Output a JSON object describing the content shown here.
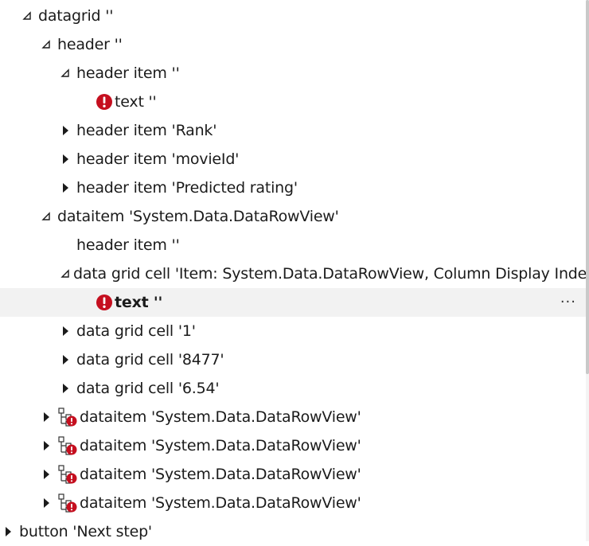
{
  "tree": {
    "rows": [
      {
        "label": "datagrid ''",
        "expander": "expanded",
        "icon": "none"
      },
      {
        "label": "header ''",
        "expander": "expanded",
        "icon": "none"
      },
      {
        "label": "header item ''",
        "expander": "expanded",
        "icon": "none"
      },
      {
        "label": "text ''",
        "expander": "none",
        "icon": "error-icon"
      },
      {
        "label": "header item 'Rank'",
        "expander": "collapsed",
        "icon": "none"
      },
      {
        "label": "header item 'movieId'",
        "expander": "collapsed",
        "icon": "none"
      },
      {
        "label": "header item 'Predicted rating'",
        "expander": "collapsed",
        "icon": "none"
      },
      {
        "label": "dataitem 'System.Data.DataRowView'",
        "expander": "expanded",
        "icon": "none"
      },
      {
        "label": "header item ''",
        "expander": "none",
        "icon": "none"
      },
      {
        "label": "data grid cell 'Item: System.Data.DataRowView, Column Display Index",
        "expander": "expanded",
        "icon": "none"
      },
      {
        "label": "text ''",
        "expander": "none",
        "icon": "error-icon",
        "selected": true,
        "more": "···"
      },
      {
        "label": "data grid cell '1'",
        "expander": "collapsed",
        "icon": "none"
      },
      {
        "label": "data grid cell '8477'",
        "expander": "collapsed",
        "icon": "none"
      },
      {
        "label": "data grid cell '6.54'",
        "expander": "collapsed",
        "icon": "none"
      },
      {
        "label": "dataitem 'System.Data.DataRowView'",
        "expander": "collapsed",
        "icon": "tree-error-icon"
      },
      {
        "label": "dataitem 'System.Data.DataRowView'",
        "expander": "collapsed",
        "icon": "tree-error-icon"
      },
      {
        "label": "dataitem 'System.Data.DataRowView'",
        "expander": "collapsed",
        "icon": "tree-error-icon"
      },
      {
        "label": "dataitem 'System.Data.DataRowView'",
        "expander": "collapsed",
        "icon": "tree-error-icon"
      },
      {
        "label": "button 'Next step'",
        "expander": "collapsed",
        "icon": "none"
      }
    ]
  },
  "colors": {
    "error": "#c50f1f",
    "selected_bg": "#f2f2f2",
    "text": "#1b1b1b"
  }
}
